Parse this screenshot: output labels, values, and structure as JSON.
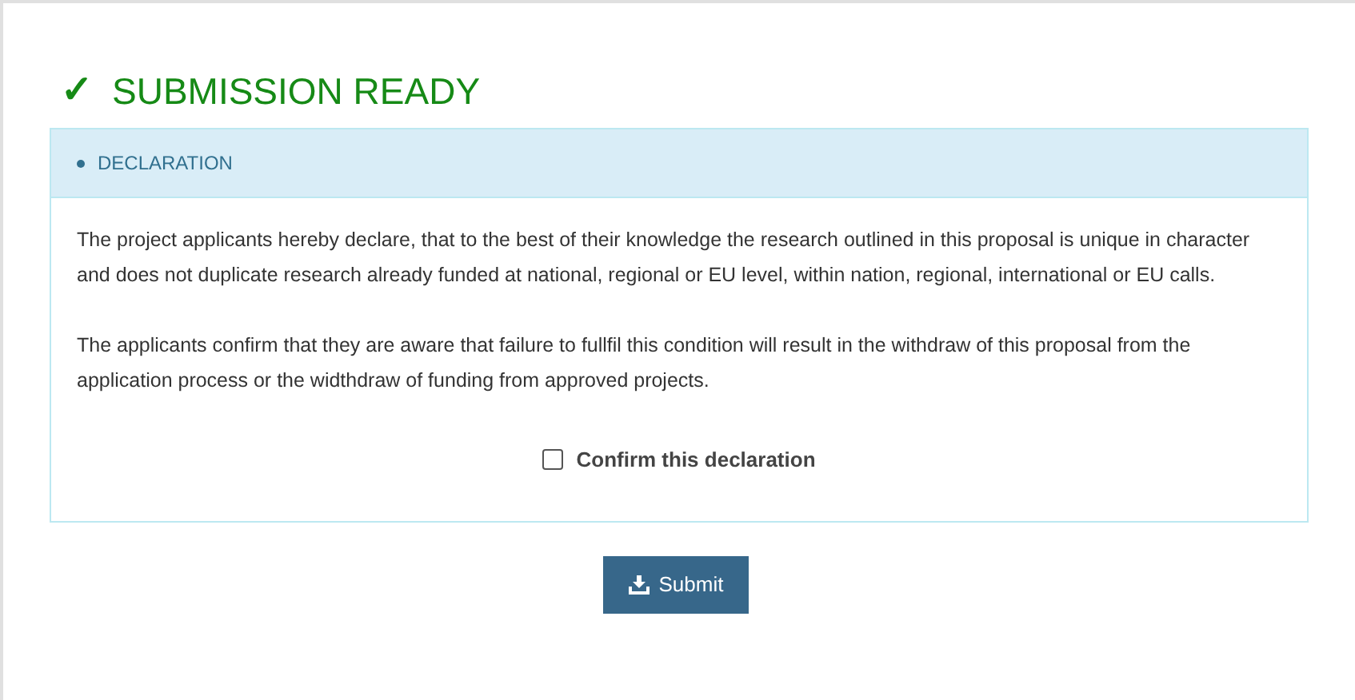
{
  "heading": {
    "icon": "✓",
    "title": "SUBMISSION READY"
  },
  "panel": {
    "title": "DECLARATION",
    "paragraphs": [
      "The project applicants hereby declare, that to the best of their knowledge the research outlined in this proposal is unique in character and does not duplicate research already funded at national, regional or EU level, within nation, regional, international or EU calls.",
      "The applicants confirm that they are aware that failure to fullfil this condition will result in the withdraw of this proposal from the application process or the widthdraw of funding from approved projects."
    ],
    "confirm": {
      "label": "Confirm this declaration",
      "checked": false
    }
  },
  "submit_button": {
    "label": "Submit"
  }
}
